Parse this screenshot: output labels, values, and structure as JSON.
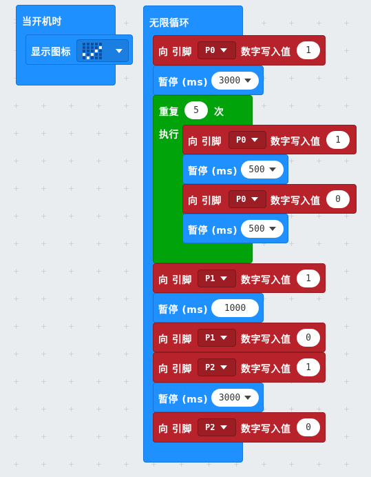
{
  "on_start": {
    "header": "当开机时",
    "show_icon_label": "显示图标",
    "icon_name": "checkmark-led-icon"
  },
  "forever": {
    "header": "无限循环",
    "pin_to_label": "向 引脚",
    "digital_write_label": "数字写入值",
    "pause_label": "暂停 (ms)",
    "repeat_label": "重复",
    "times_label": "次",
    "do_label": "执行",
    "steps": [
      {
        "pin": "P0",
        "value": "1"
      },
      {
        "pause": "3000"
      },
      {
        "repeat": "5",
        "inner": [
          {
            "pin": "P0",
            "value": "1"
          },
          {
            "pause": "500"
          },
          {
            "pin": "P0",
            "value": "0"
          },
          {
            "pause": "500"
          }
        ]
      },
      {
        "pin": "P1",
        "value": "1"
      },
      {
        "pause": "1000"
      },
      {
        "pin": "P1",
        "value": "0"
      },
      {
        "pin": "P2",
        "value": "1"
      },
      {
        "pause": "3000"
      },
      {
        "pin": "P2",
        "value": "0"
      }
    ]
  },
  "colors": {
    "loops_blue": "#1e90ff",
    "pins_red": "#b8222a",
    "repeat_green": "#00a30a",
    "workspace_bg": "#e9edf0"
  }
}
